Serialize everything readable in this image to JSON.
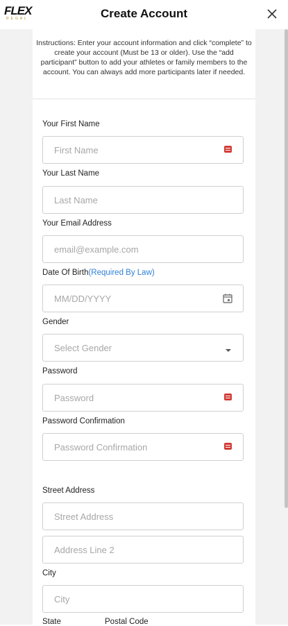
{
  "header": {
    "logo_text": "FLEX",
    "logo_sub": "REGAL",
    "title": "Create Account"
  },
  "instructions": "Instructions: Enter your account information and click “complete” to create your account (Must be 13 or older). Use the “add participant” button to add your athletes or family members to the account. You can always add more participants later if needed.",
  "form": {
    "first_name": {
      "label": "Your First Name",
      "placeholder": "First Name"
    },
    "last_name": {
      "label": "Your Last Name",
      "placeholder": "Last Name"
    },
    "email": {
      "label": "Your Email Address",
      "placeholder": "email@example.com"
    },
    "dob": {
      "label": "Date Of Birth",
      "required_note": "(Required By Law)",
      "placeholder": "MM/DD/YYYY"
    },
    "gender": {
      "label": "Gender",
      "placeholder": "Select Gender"
    },
    "password": {
      "label": "Password",
      "placeholder": "Password"
    },
    "password_confirm": {
      "label": "Password Confirmation",
      "placeholder": "Password Confirmation"
    },
    "street": {
      "label": "Street Address",
      "placeholder": "Street Address"
    },
    "address2": {
      "placeholder": "Address Line 2"
    },
    "city": {
      "label": "City",
      "placeholder": "City"
    },
    "state": {
      "label": "State"
    },
    "postal": {
      "label": "Postal Code"
    }
  },
  "colors": {
    "accent": "#2f80d6",
    "key_icon": "#d23b35",
    "background": "#f2f2f2"
  }
}
